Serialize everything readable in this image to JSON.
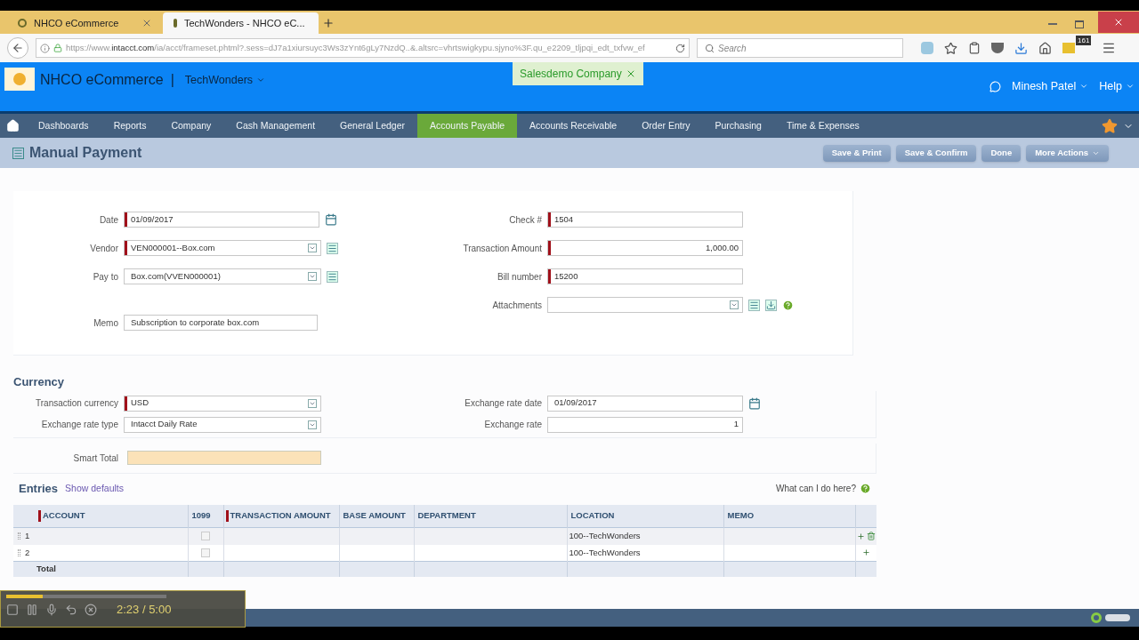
{
  "browser": {
    "tabs": [
      {
        "title": "NHCO eCommerce",
        "selected": false
      },
      {
        "title": "TechWonders - NHCO eC...",
        "selected": true
      }
    ],
    "url_prefix": "https://www.",
    "url_domain": "intacct.com",
    "url_rest": "/ia/acct/frameset.phtml?.sess=dJ7a1xiursuyc3Ws3zYnt6gLy7NzdQ..&.altsrc=vhrtswigkypu.sjyno%3F.qu_e2209_tljpqi_edt_txfvw_ef",
    "search_placeholder": "Search",
    "badge": "161"
  },
  "header": {
    "company": "NHCO eCommerce",
    "separator": "|",
    "entity": "TechWonders",
    "notice": "Salesdemo Company",
    "user": "Minesh Patel",
    "help": "Help"
  },
  "nav": [
    {
      "label": "Dashboards",
      "selected": false
    },
    {
      "label": "Reports",
      "selected": false
    },
    {
      "label": "Company",
      "selected": false
    },
    {
      "label": "Cash Management",
      "selected": false
    },
    {
      "label": "General Ledger",
      "selected": false
    },
    {
      "label": "Accounts Payable",
      "selected": true
    },
    {
      "label": "Accounts Receivable",
      "selected": false
    },
    {
      "label": "Order Entry",
      "selected": false
    },
    {
      "label": "Purchasing",
      "selected": false
    },
    {
      "label": "Time & Expenses",
      "selected": false
    }
  ],
  "page": {
    "title": "Manual Payment",
    "actions": [
      {
        "label": "Save & Print",
        "kind": "button"
      },
      {
        "label": "Save & Confirm",
        "kind": "button"
      },
      {
        "label": "Done",
        "kind": "button"
      },
      {
        "label": "More Actions",
        "kind": "menu"
      }
    ]
  },
  "form_left": [
    {
      "label": "Date",
      "value": "01/09/2017",
      "required": true,
      "kind": "date"
    },
    {
      "label": "Vendor",
      "value": "VEN000001--Box.com",
      "required": true,
      "kind": "lookup"
    },
    {
      "label": "Pay to",
      "value": "Box.com(VVEN000001)",
      "required": false,
      "kind": "lookup"
    },
    {
      "label": "Memo",
      "value": "Subscription to corporate box.com",
      "required": false,
      "kind": "text"
    }
  ],
  "form_right": [
    {
      "label": "Check #",
      "value": "1504",
      "required": true,
      "kind": "text"
    },
    {
      "label": "Transaction Amount",
      "value": "1,000.00",
      "required": true,
      "kind": "number"
    },
    {
      "label": "Bill number",
      "value": "15200",
      "required": true,
      "kind": "text"
    },
    {
      "label": "Attachments",
      "required": false,
      "kind": "attachment"
    }
  ],
  "currency": {
    "title": "Currency",
    "left": [
      {
        "label": "Transaction currency",
        "value": "USD",
        "required": true,
        "kind": "select"
      },
      {
        "label": "Exchange rate type",
        "value": "Intacct Daily Rate",
        "required": false,
        "kind": "select"
      }
    ],
    "right": [
      {
        "label": "Exchange rate date",
        "value": "01/09/2017",
        "required": false,
        "kind": "date"
      },
      {
        "label": "Exchange rate",
        "value": "1",
        "required": false,
        "kind": "number"
      }
    ]
  },
  "smart_total": {
    "label": "Smart Total"
  },
  "entries": {
    "title": "Entries",
    "link": "Show defaults",
    "help": "What can I do here?",
    "columns": [
      {
        "label": "ACCOUNT",
        "required": true
      },
      {
        "label": "1099",
        "required": false
      },
      {
        "label": "TRANSACTION AMOUNT",
        "required": true
      },
      {
        "label": "BASE AMOUNT",
        "required": false
      },
      {
        "label": "DEPARTMENT",
        "required": false
      },
      {
        "label": "LOCATION",
        "required": false
      },
      {
        "label": "MEMO",
        "required": false
      }
    ],
    "rows": [
      {
        "number": "1",
        "checked": false,
        "location": "100--TechWonders",
        "deletable": true
      },
      {
        "number": "2",
        "checked": false,
        "location": "100--TechWonders",
        "deletable": false
      }
    ],
    "total_label": "Total"
  },
  "player": {
    "time": "2:23 / 5:00",
    "level": 0.23
  }
}
